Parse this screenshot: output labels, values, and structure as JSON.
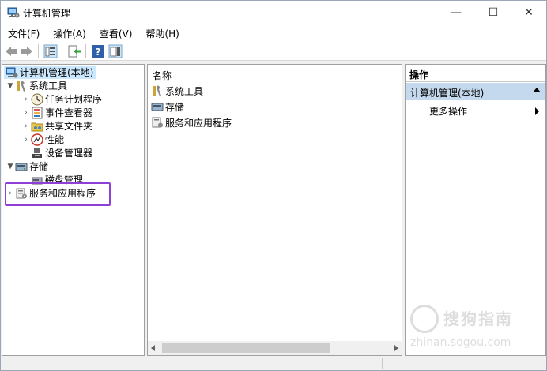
{
  "window": {
    "title": "计算机管理"
  },
  "window_controls": {
    "minimize": "—",
    "maximize": "☐",
    "close": "✕"
  },
  "menu": [
    "文件(F)",
    "操作(A)",
    "查看(V)",
    "帮助(H)"
  ],
  "tree": {
    "root": "计算机管理(本地)",
    "system_tools": "系统工具",
    "task_scheduler": "任务计划程序",
    "event_viewer": "事件查看器",
    "shared_folders": "共享文件夹",
    "performance": "性能",
    "device_manager": "设备管理器",
    "storage": "存储",
    "disk_management": "磁盘管理",
    "services_apps": "服务和应用程序"
  },
  "list": {
    "header": "名称",
    "items": [
      "系统工具",
      "存储",
      "服务和应用程序"
    ]
  },
  "actions": {
    "header": "操作",
    "selected": "计算机管理(本地)",
    "more": "更多操作"
  },
  "watermark": {
    "text": "搜狗指南",
    "url": "zhinan.sogou.com"
  }
}
